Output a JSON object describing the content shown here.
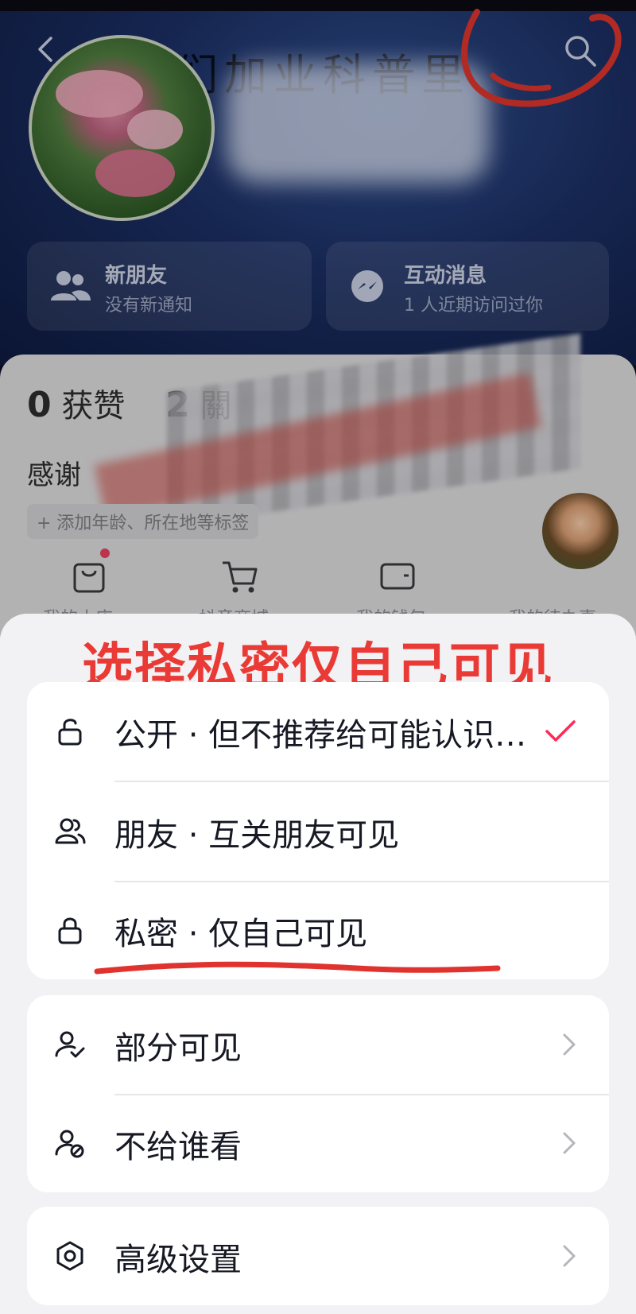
{
  "profile_header": {
    "calligraphy_text": "们加业科普里"
  },
  "cards": [
    {
      "title": "新朋友",
      "subtitle": "没有新通知",
      "icon": "people-icon"
    },
    {
      "title": "互动消息",
      "subtitle": "1 人近期访问过你",
      "icon": "messenger-icon"
    }
  ],
  "stats": {
    "likes_count": "0",
    "likes_label": "获赞",
    "second_count": "2",
    "second_label": "關"
  },
  "bio": "感谢",
  "tag_button": "+ 添加年龄、所在地等标签",
  "quick_actions": [
    "我的小店",
    "抖音商城",
    "我的钱包",
    "我的待办事"
  ],
  "annotation": {
    "title": "选择私密仅自己可见",
    "accent_color": "#ea3a36"
  },
  "visibility_options": [
    {
      "label": "公开 · 但不推荐给可能认识…",
      "icon": "unlock-icon",
      "selected": true
    },
    {
      "label": "朋友 · 互关朋友可见",
      "icon": "friends-icon",
      "selected": false
    },
    {
      "label": "私密 · 仅自己可见",
      "icon": "lock-icon",
      "selected": false
    }
  ],
  "partial_options": [
    {
      "label": "部分可见",
      "icon": "user-check-icon"
    },
    {
      "label": "不给谁看",
      "icon": "user-block-icon"
    }
  ],
  "advanced": {
    "label": "高级设置",
    "icon": "settings-icon"
  },
  "colors": {
    "check": "#fe2c55",
    "sheet_bg": "#f2f2f4",
    "text": "#161823"
  }
}
